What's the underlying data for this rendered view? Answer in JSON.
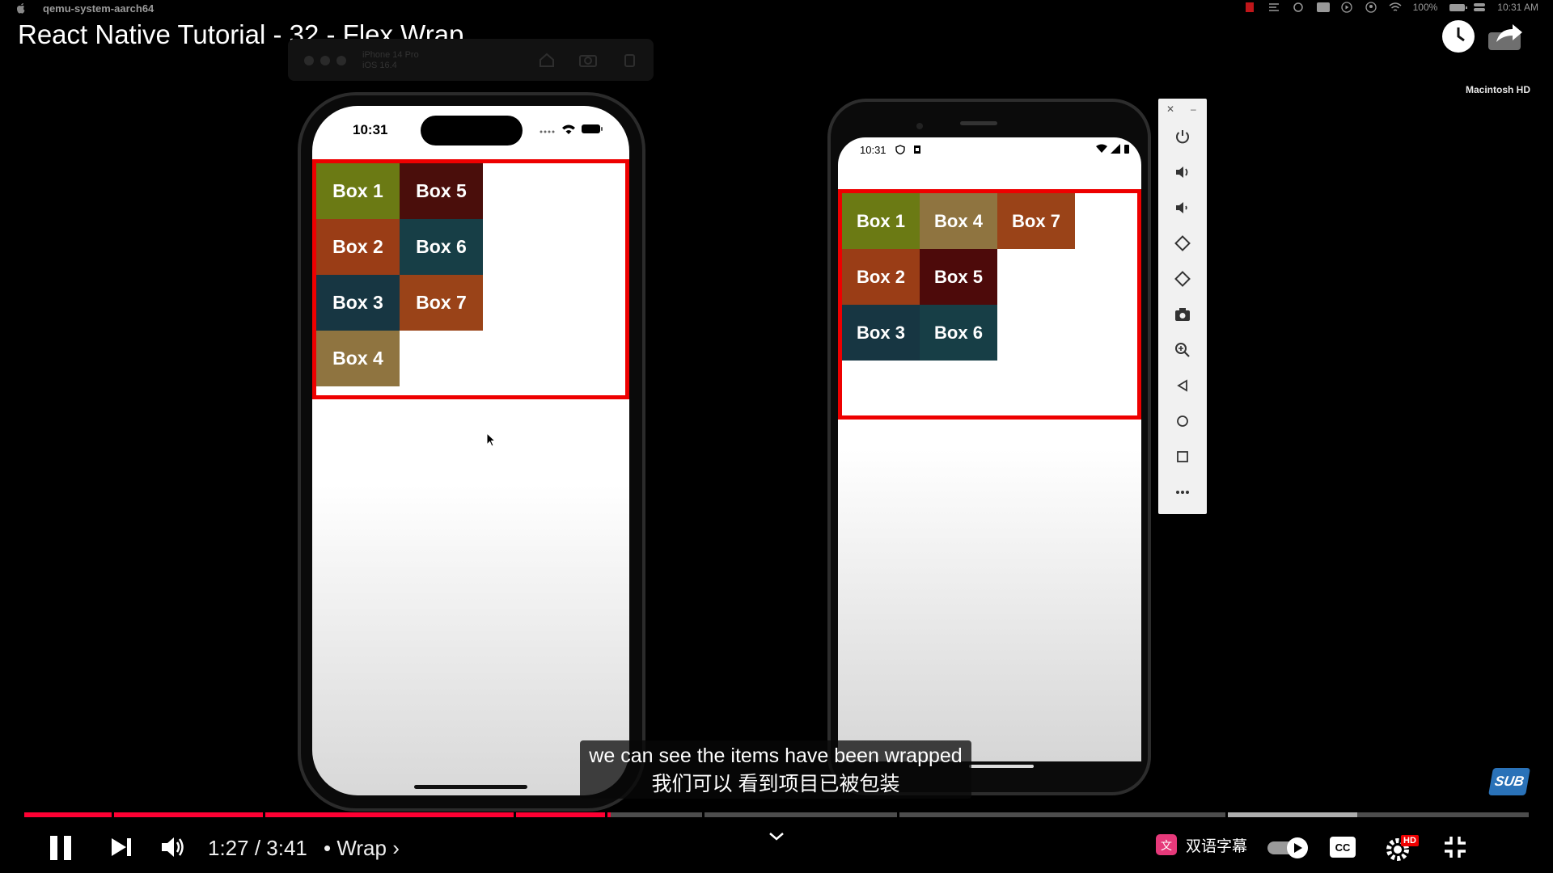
{
  "menubar": {
    "app_name": "qemu-system-aarch64",
    "battery": "100%",
    "clock": "10:31 AM"
  },
  "video": {
    "title": "React Native Tutorial - 32 - Flex Wrap",
    "drive_label": "Macintosh HD"
  },
  "simulator": {
    "device": "iPhone 14 Pro",
    "os": "iOS 16.4"
  },
  "ios": {
    "time": "10:31",
    "boxes": [
      {
        "label": "Box 1",
        "color": "#6b7a14"
      },
      {
        "label": "Box 2",
        "color": "#9a3d16"
      },
      {
        "label": "Box 3",
        "color": "#173642"
      },
      {
        "label": "Box 4",
        "color": "#8f7440"
      },
      {
        "label": "Box 5",
        "color": "#4a0e0b"
      },
      {
        "label": "Box 6",
        "color": "#173e46"
      },
      {
        "label": "Box 7",
        "color": "#9a4318"
      }
    ]
  },
  "android": {
    "time": "10:31",
    "boxes": [
      {
        "label": "Box 1",
        "color": "#6b7a14"
      },
      {
        "label": "Box 2",
        "color": "#9a3d16"
      },
      {
        "label": "Box 3",
        "color": "#173642"
      },
      {
        "label": "Box 4",
        "color": "#8f7440"
      },
      {
        "label": "Box 5",
        "color": "#4d0a0a"
      },
      {
        "label": "Box 6",
        "color": "#173e46"
      },
      {
        "label": "Box 7",
        "color": "#9a4318"
      }
    ]
  },
  "caption": {
    "line1": "we can see the items have been wrapped",
    "line2": "我们可以 看到项目已被包装"
  },
  "player": {
    "current_time": "1:27",
    "separator": " / ",
    "duration": "3:41",
    "chapter": "• Wrap ›",
    "progress_fraction": 0.39,
    "bilingual_label": "双语字幕",
    "sub_badge": "SUB",
    "hd_badge": "HD",
    "cc_label": "CC",
    "accent_color": "#ff0033"
  }
}
